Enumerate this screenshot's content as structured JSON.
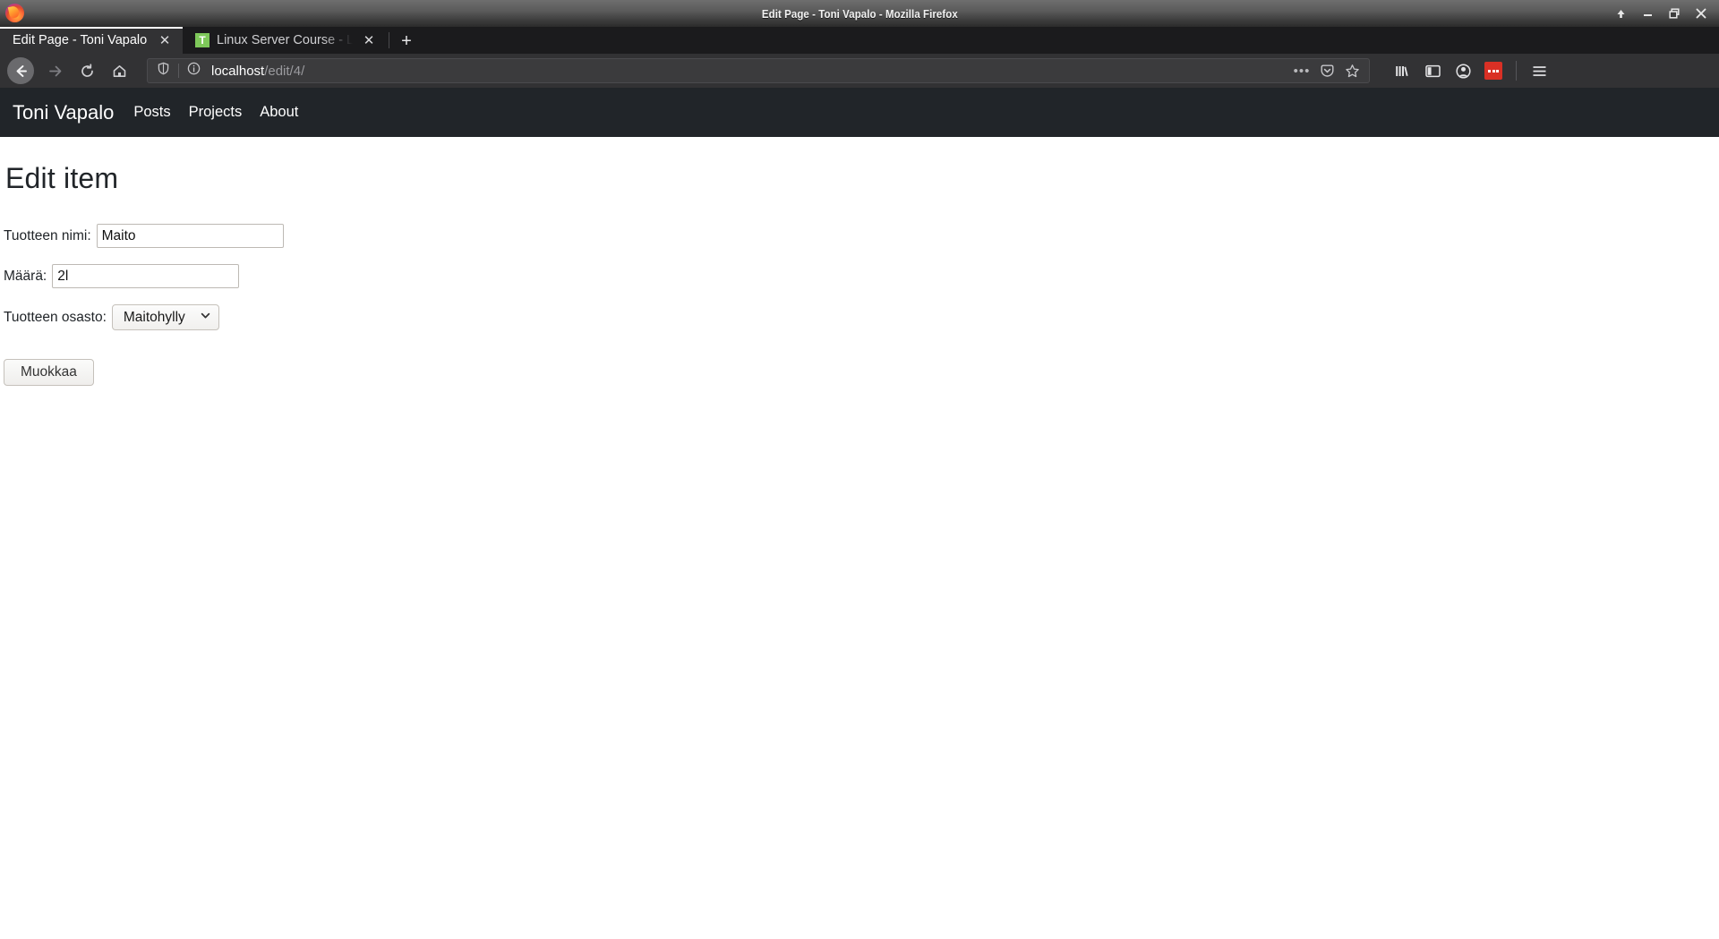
{
  "window": {
    "title": "Edit Page - Toni Vapalo - Mozilla Firefox",
    "controls": {
      "rollup_label": "↑",
      "minimize_label": "–",
      "restore_label": "❐",
      "close_label": "✕"
    }
  },
  "tabs": [
    {
      "title": "Edit Page - Toni Vapalo",
      "favicon": "none",
      "active": true,
      "close_label": "✕"
    },
    {
      "title": "Linux Server Course - Linux",
      "favicon": "T",
      "favicon_color": "#7ec85a",
      "active": false,
      "close_label": "✕"
    }
  ],
  "newtab_label": "+",
  "browser_toolbar": {
    "back_icon": "back-arrow-icon",
    "forward_icon": "forward-arrow-icon",
    "reload_icon": "reload-icon",
    "home_icon": "home-icon",
    "url": {
      "host": "localhost",
      "path": "/edit/4/"
    },
    "identity_icons": [
      "shield-icon",
      "info-icon"
    ],
    "page_actions_label": "•••",
    "pocket_icon": "pocket-icon",
    "bookmark_icon": "star-icon",
    "library_icon": "library-icon",
    "sidebar_icon": "sidebar-icon",
    "account_icon": "account-icon",
    "extension_icon": "lastpass-extension-icon",
    "extension_color": "#d93025",
    "menu_icon": "hamburger-menu-icon"
  },
  "site": {
    "brand": "Toni Vapalo",
    "nav_links": [
      "Posts",
      "Projects",
      "About"
    ],
    "navbar_color": "#212529"
  },
  "main": {
    "title": "Edit item",
    "fields": [
      {
        "label": "Tuotteen nimi:",
        "value": "Maito",
        "placeholder": ""
      },
      {
        "label": "Määrä:",
        "value": "2l",
        "placeholder": ""
      }
    ],
    "select": {
      "label": "Tuotteen osasto:",
      "value": "Maitohylly",
      "options": [
        "Maitohylly"
      ]
    },
    "submit_label": "Muokkaa"
  }
}
